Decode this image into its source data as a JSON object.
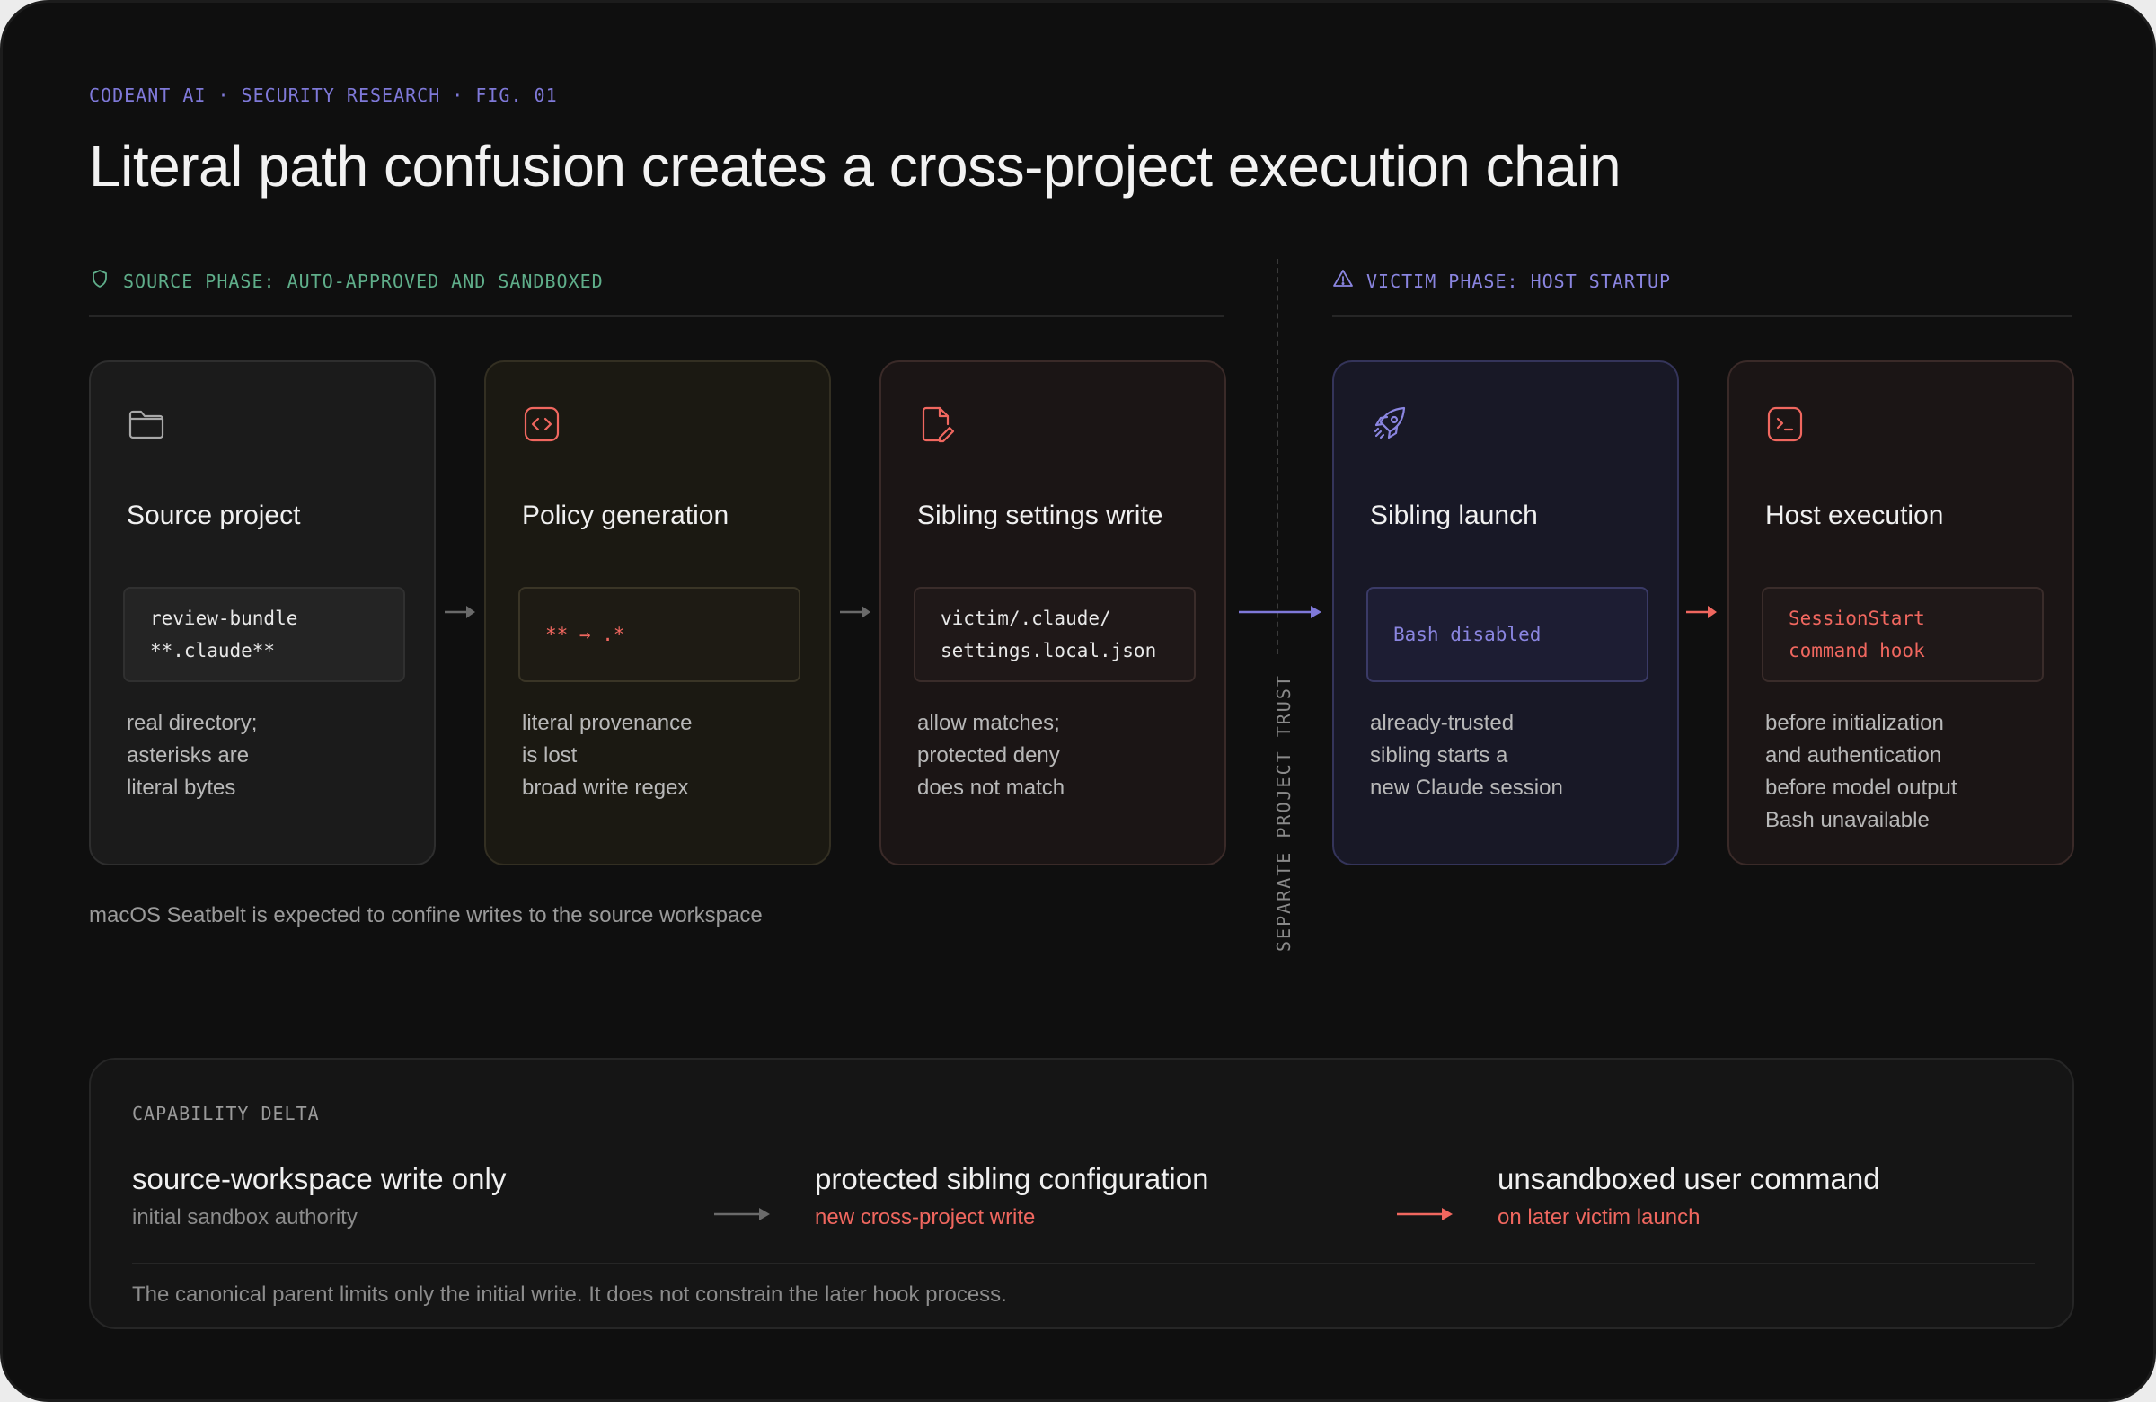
{
  "header": {
    "eyebrow": "CODEANT AI · SECURITY RESEARCH · FIG. 01",
    "title": "Literal path confusion creates a cross-project execution chain"
  },
  "phases": {
    "source": {
      "label": "SOURCE PHASE: AUTO-APPROVED AND SANDBOXED",
      "icon": "shield-icon"
    },
    "victim": {
      "label": "VICTIM PHASE: HOST STARTUP",
      "icon": "warning-triangle-icon"
    }
  },
  "steps": [
    {
      "icon": "folder-icon",
      "title": "Source project",
      "code": [
        "review-bundle",
        "**.claude**"
      ],
      "desc": [
        "real directory;",
        "asterisks are",
        "literal bytes"
      ]
    },
    {
      "icon": "code-brackets-icon",
      "title": "Policy generation",
      "code": [
        "** → .*"
      ],
      "desc": [
        "literal provenance",
        "is lost",
        "broad write regex"
      ]
    },
    {
      "icon": "file-edit-icon",
      "title": "Sibling settings write",
      "code": [
        "victim/.claude/",
        "settings.local.json"
      ],
      "desc": [
        "allow matches;",
        "protected deny",
        "does not match"
      ]
    },
    {
      "icon": "rocket-icon",
      "title": "Sibling launch",
      "code": [
        "Bash disabled"
      ],
      "desc": [
        "already-trusted",
        "sibling starts a",
        "new Claude session"
      ]
    },
    {
      "icon": "terminal-icon",
      "title": "Host execution",
      "code": [
        "SessionStart",
        "command hook"
      ],
      "desc": [
        "before initialization",
        "and authentication",
        "before model output",
        "Bash unavailable"
      ]
    }
  ],
  "divider_label": "SEPARATE PROJECT TRUST",
  "source_note": "macOS Seatbelt is expected to confine writes to the source workspace",
  "capability": {
    "label": "CAPABILITY DELTA",
    "items": [
      {
        "main": "source-workspace write only",
        "sub": "initial sandbox authority"
      },
      {
        "main": "protected sibling configuration",
        "sub": "new cross-project write"
      },
      {
        "main": "unsandboxed user command",
        "sub": "on later victim launch"
      }
    ],
    "footer": "The canonical parent limits only the initial write. It does not constrain the later hook process."
  },
  "colors": {
    "background": "#0f0f0f",
    "accent_purple": "#7f79d9",
    "accent_green": "#5fae8a",
    "accent_red": "#f0675f",
    "neutral_arrow": "#6a6a6a"
  }
}
